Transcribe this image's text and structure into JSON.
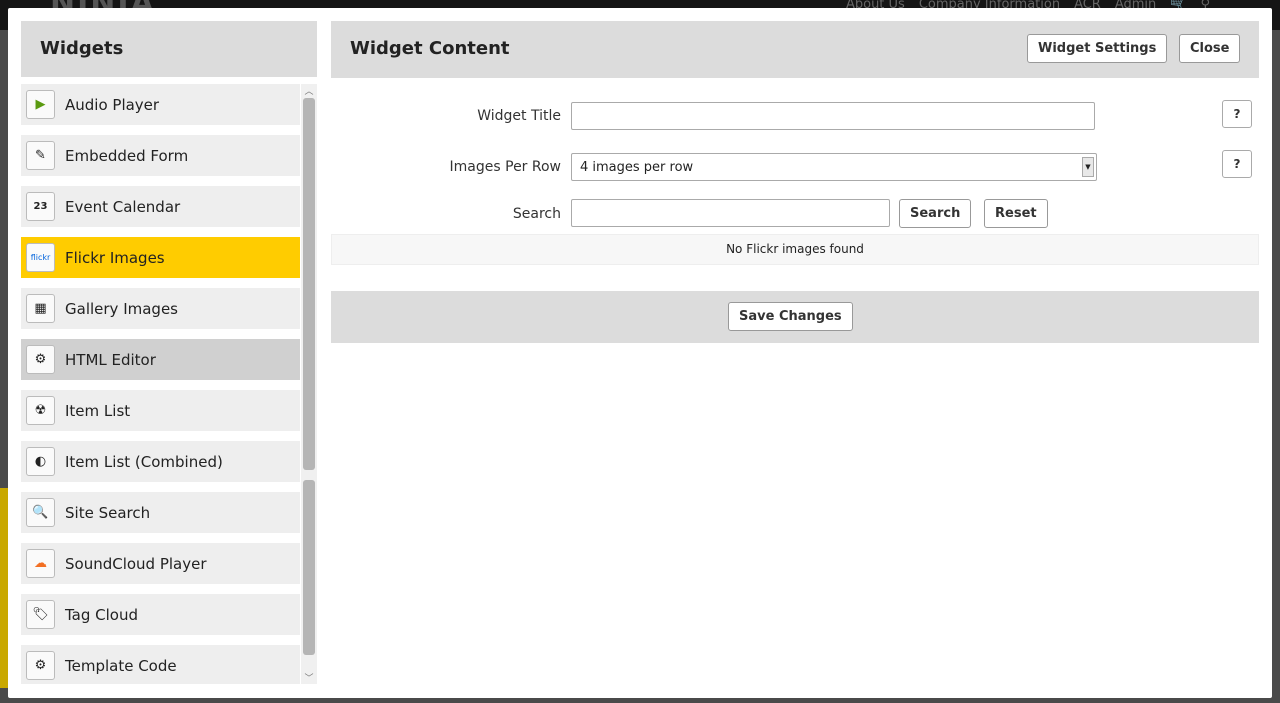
{
  "background": {
    "logo": "NINJA",
    "nav": [
      "About Us",
      "Company Information",
      "ACR",
      "Admin"
    ]
  },
  "widgets": {
    "title": "Widgets",
    "items": [
      {
        "label": "Audio Player",
        "icon": "play-icon",
        "state": ""
      },
      {
        "label": "Embedded Form",
        "icon": "form-icon",
        "state": ""
      },
      {
        "label": "Event Calendar",
        "icon": "calendar-icon",
        "state": ""
      },
      {
        "label": "Flickr Images",
        "icon": "flickr-icon",
        "state": "selected"
      },
      {
        "label": "Gallery Images",
        "icon": "gallery-icon",
        "state": ""
      },
      {
        "label": "HTML Editor",
        "icon": "gear-icon",
        "state": "hover"
      },
      {
        "label": "Item List",
        "icon": "item-list-icon",
        "state": ""
      },
      {
        "label": "Item List (Combined)",
        "icon": "item-list-combined-icon",
        "state": ""
      },
      {
        "label": "Site Search",
        "icon": "magnifier-icon",
        "state": ""
      },
      {
        "label": "SoundCloud Player",
        "icon": "soundcloud-icon",
        "state": ""
      },
      {
        "label": "Tag Cloud",
        "icon": "tag-icon",
        "state": ""
      },
      {
        "label": "Template Code",
        "icon": "gear-icon",
        "state": ""
      }
    ],
    "icon_glyphs": {
      "play-icon": "▶",
      "form-icon": "✎",
      "calendar-icon": "23",
      "flickr-icon": "flickr",
      "gallery-icon": "▦",
      "gear-icon": "⚙",
      "item-list-icon": "☢",
      "item-list-combined-icon": "◐",
      "magnifier-icon": "🔍",
      "soundcloud-icon": "☁",
      "tag-icon": "🏷"
    }
  },
  "content": {
    "title": "Widget Content",
    "settings_label": "Widget Settings",
    "close_label": "Close",
    "widget_title_label": "Widget Title",
    "widget_title_value": "",
    "images_per_row_label": "Images Per Row",
    "images_per_row_value": "4 images per row",
    "search_label": "Search",
    "search_value": "",
    "search_button": "Search",
    "reset_button": "Reset",
    "help": "?",
    "message": "No Flickr images found",
    "save_label": "Save Changes"
  },
  "colors": {
    "selected": "#ffcc00",
    "panel_header": "#dcdcdc"
  }
}
